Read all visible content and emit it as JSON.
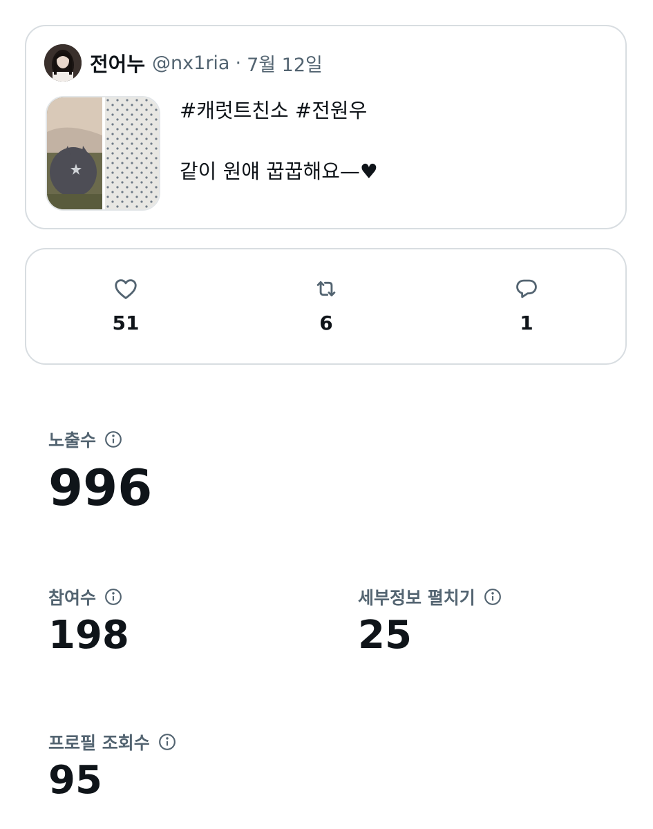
{
  "tweet": {
    "author_name": "전어누",
    "handle": "@nx1ria",
    "separator": "·",
    "date": "7월 12일",
    "text_line1": "#캐럿트친소 #전원우",
    "text_line2": "같이 원얘 꿉꿉해요—♥",
    "avatar_icon": "profile-photo",
    "media_icon": "cat-photo-thumbnail"
  },
  "engagement": {
    "likes": {
      "icon": "heart-icon",
      "count": "51"
    },
    "retweets": {
      "icon": "retweet-icon",
      "count": "6"
    },
    "replies": {
      "icon": "reply-icon",
      "count": "1"
    },
    "icon_color": "#536471"
  },
  "metrics": {
    "impressions": {
      "label": "노출수",
      "value": "996"
    },
    "engagements": {
      "label": "참여수",
      "value": "198"
    },
    "detail_expands": {
      "label": "세부정보 펼치기",
      "value": "25"
    },
    "profile_visits": {
      "label": "프로필 조회수",
      "value": "95"
    }
  }
}
